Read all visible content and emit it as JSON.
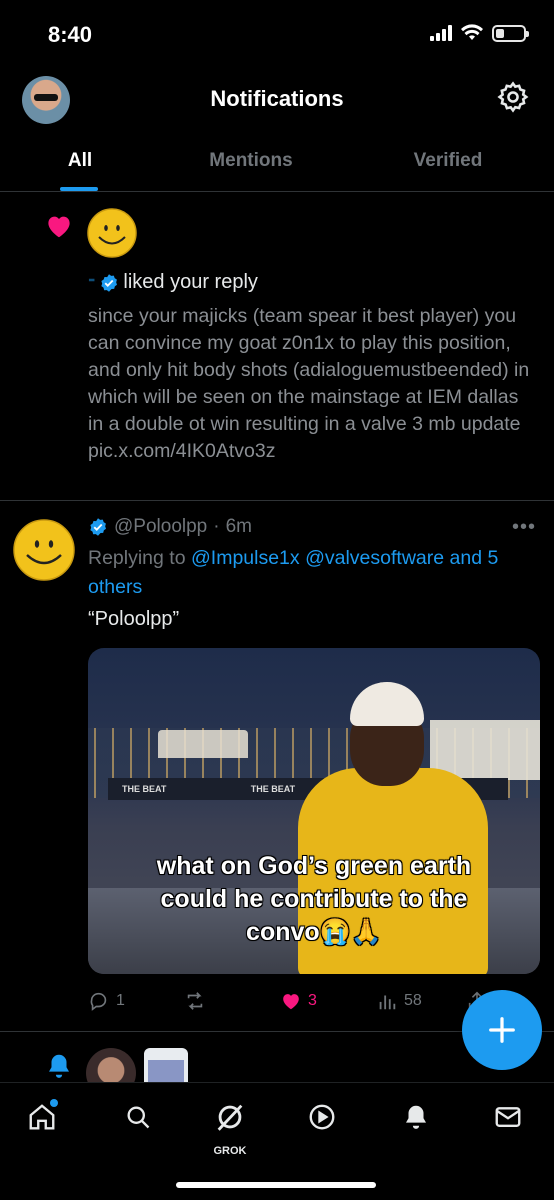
{
  "status_bar": {
    "time": "8:40"
  },
  "header": {
    "title": "Notifications"
  },
  "tabs": [
    {
      "label": "All",
      "active": true
    },
    {
      "label": "Mentions",
      "active": false
    },
    {
      "label": "Verified",
      "active": false
    }
  ],
  "like_notification": {
    "action_text": "liked your reply",
    "reply_text": "since your majicks (team spear it best player) you can convince my goat z0n1x to play this position, and only hit body shots (adialoguemustbeended) in which will be seen on the mainstage at IEM dallas in a double ot win resulting in a valve 3 mb update pic.x.com/4IK0Atvo3z"
  },
  "tweet": {
    "handle": "@Poloolpp",
    "separator": "·",
    "time": "6m",
    "replying_prefix": "Replying to",
    "mention_1": "@Impulse1x",
    "mention_2": "@valvesoftware",
    "and_others": "and 5 others",
    "text": "“Poloolpp”",
    "media_caption_1": "what on God’s green earth",
    "media_caption_2": "could he contribute to the",
    "media_caption_3": "convo😭🙏",
    "media_sign": "THE BEAT",
    "replies": "1",
    "reposts": "",
    "likes": "3",
    "views": "58"
  },
  "bottom_nav": {
    "grok_label": "GROK"
  },
  "colors": {
    "accent": "#1d9bf0",
    "like": "#f91880",
    "muted": "#71767b",
    "background": "#000000"
  }
}
